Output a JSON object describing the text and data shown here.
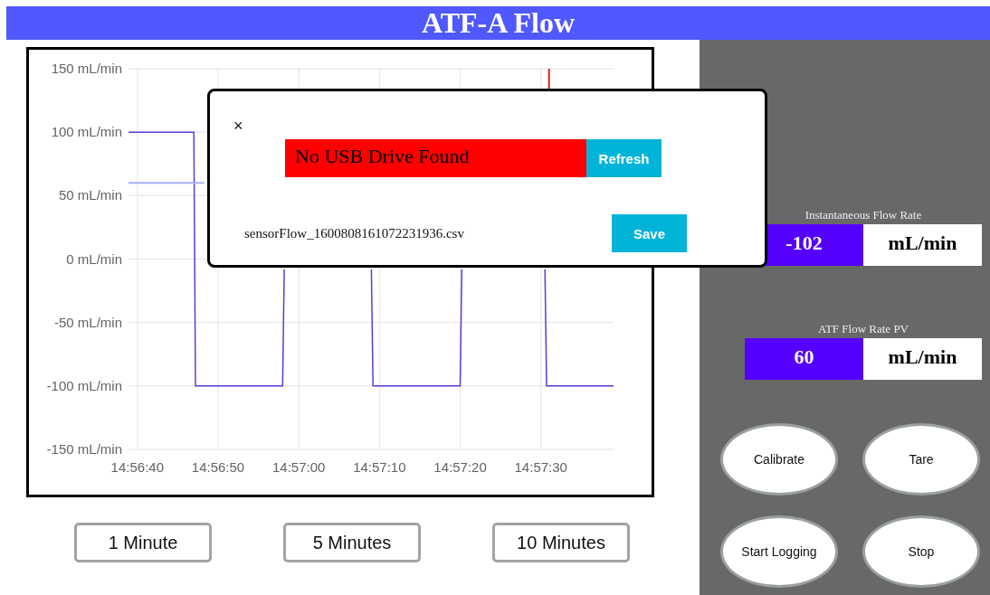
{
  "header": {
    "title": "ATF-A Flow"
  },
  "chart": {
    "chart_data": {
      "type": "line",
      "grid": true,
      "x": [
        53798.9,
        53807,
        53807.2,
        53808.3,
        53818,
        53818.2,
        53823,
        53829,
        53829.2,
        53840,
        53840.2,
        53845,
        53850.5,
        53850.7,
        53851,
        53851,
        53859
      ],
      "series": [
        {
          "color": "#5040e0",
          "values": [
            100,
            100,
            -100,
            -100,
            -100,
            -8,
            null,
            -8,
            -100,
            -100,
            -8,
            null,
            -8,
            -100,
            -100,
            -100,
            -100
          ]
        },
        {
          "color": "#aab0ff",
          "values": [
            60,
            60,
            60,
            60,
            null,
            null,
            null,
            null,
            null,
            null,
            null,
            null,
            null,
            null,
            null,
            null,
            null
          ]
        },
        {
          "color": "#e02020",
          "values": [
            null,
            null,
            null,
            null,
            null,
            null,
            null,
            null,
            null,
            null,
            null,
            null,
            null,
            null,
            150,
            134,
            null
          ]
        }
      ],
      "xlim": [
        53798.9,
        53859
      ],
      "ylim": [
        -150,
        150
      ],
      "xticks": [
        {
          "value": 53800,
          "label": "14:56:40"
        },
        {
          "value": 53810,
          "label": "14:56:50"
        },
        {
          "value": 53820,
          "label": "14:57:00"
        },
        {
          "value": 53830,
          "label": "14:57:10"
        },
        {
          "value": 53840,
          "label": "14:57:20"
        },
        {
          "value": 53850,
          "label": "14:57:30"
        }
      ],
      "yticks": [
        {
          "value": 150,
          "label": "150 mL/min"
        },
        {
          "value": 100,
          "label": "100 mL/min"
        },
        {
          "value": 50,
          "label": "50 mL/min"
        },
        {
          "value": 0,
          "label": "0 mL/min"
        },
        {
          "value": -50,
          "label": "-50 mL/min"
        },
        {
          "value": -100,
          "label": "-100 mL/min"
        },
        {
          "value": -150,
          "label": "-150 mL/min"
        }
      ]
    }
  },
  "range_buttons": [
    {
      "label": "1 Minute"
    },
    {
      "label": "5 Minutes"
    },
    {
      "label": "10 Minutes"
    }
  ],
  "readouts": [
    {
      "label": "Instantaneous Flow Rate",
      "value": "-102",
      "unit": "mL/min"
    },
    {
      "label": "ATF Flow Rate PV",
      "value": "60",
      "unit": "mL/min"
    }
  ],
  "buttons": [
    "Calibrate",
    "Tare",
    "Start Logging",
    "Stop"
  ],
  "dialog": {
    "close": "×",
    "status": "No USB Drive Found",
    "refresh": "Refresh",
    "filename": "sensorFlow_1600808161072231936.csv",
    "save": "Save"
  }
}
